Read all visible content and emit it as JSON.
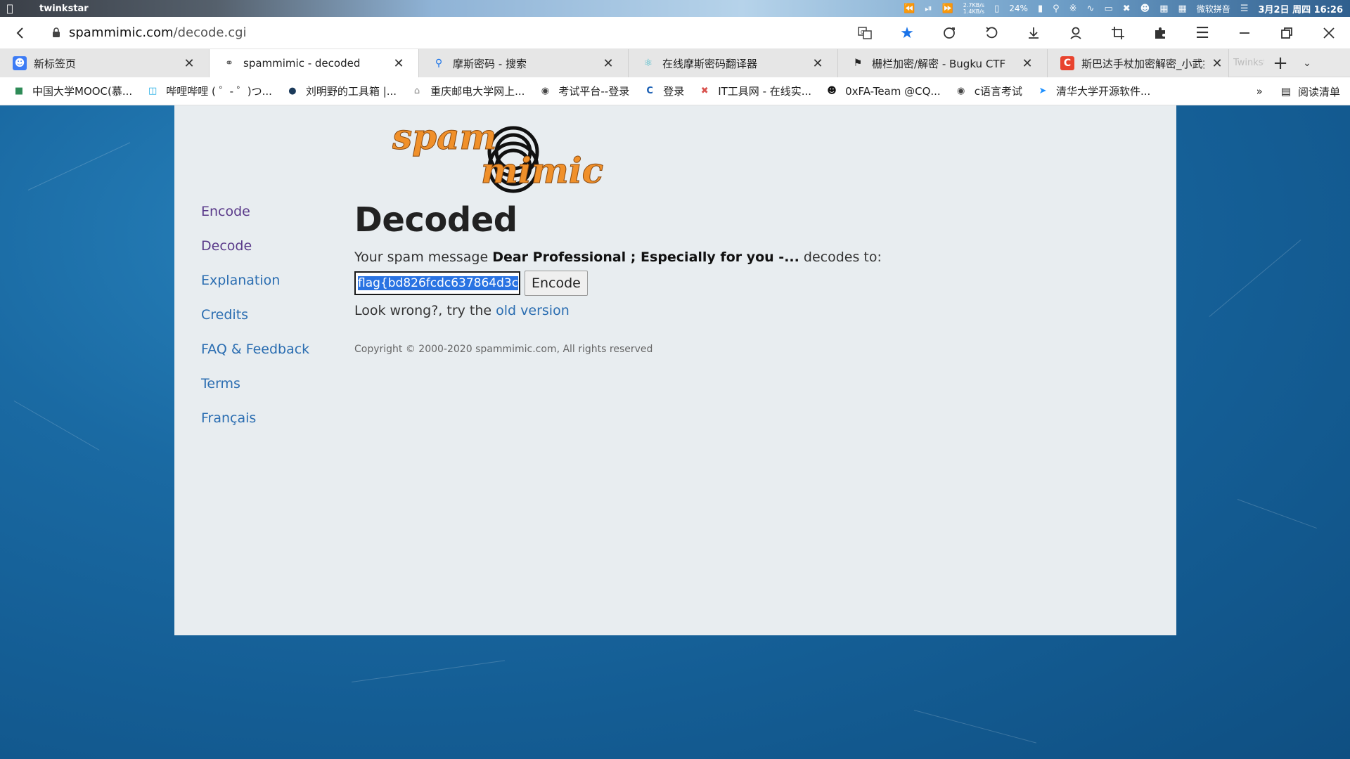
{
  "system": {
    "user": "twinkstar",
    "net_up": "2.7KB/s",
    "net_down": "1.4KB/s",
    "battery": "24%",
    "ime": "微软拼音",
    "clock": "3月2日 周四 16:26"
  },
  "address": {
    "domain": "spammimic.com",
    "path": "/decode.cgi"
  },
  "tabs": [
    {
      "label": "新标签页",
      "icon": "new-tab-icon",
      "color": "#3d7cf5"
    },
    {
      "label": "spammimic - decoded",
      "icon": "spammimic-favicon",
      "color": "#555555"
    },
    {
      "label": "摩斯密码 - 搜索",
      "icon": "search-icon",
      "color": "#1a73e8"
    },
    {
      "label": "在线摩斯密码翻译器",
      "icon": "react-icon",
      "color": "#3fb8c9"
    },
    {
      "label": "栅栏加密/解密 - Bugku CTF",
      "icon": "flag-icon",
      "color": "#222222"
    },
    {
      "label": "斯巴达手杖加密解密_小武搞渗",
      "icon": "csdn-icon",
      "color": "#e8432e"
    }
  ],
  "tab_overflow_text": "Twinkstar Browser",
  "bookmarks": [
    {
      "label": "中国大学MOOC(慕...",
      "icon": "mooc-icon"
    },
    {
      "label": "哔哩哔哩 ( ゜- ゜)つ...",
      "icon": "bilibili-icon"
    },
    {
      "label": "刘明野的工具箱 |...",
      "icon": "toolbox-icon"
    },
    {
      "label": "重庆邮电大学网上...",
      "icon": "home-icon"
    },
    {
      "label": "考试平台--登录",
      "icon": "globe-icon"
    },
    {
      "label": "登录",
      "icon": "c-icon"
    },
    {
      "label": "IT工具网 - 在线实...",
      "icon": "tools-icon"
    },
    {
      "label": "0xFA-Team @CQ...",
      "icon": "cat-icon"
    },
    {
      "label": "c语言考试",
      "icon": "globe-icon"
    },
    {
      "label": "清华大学开源软件...",
      "icon": "tuna-icon"
    }
  ],
  "reader_mode": "阅读清单",
  "nav": [
    {
      "label": "Encode"
    },
    {
      "label": "Decode"
    },
    {
      "label": "Explanation"
    },
    {
      "label": "Credits"
    },
    {
      "label": "FAQ & Feedback"
    },
    {
      "label": "Terms"
    },
    {
      "label": "Français"
    }
  ],
  "page": {
    "title": "Decoded",
    "msg_prefix": "Your spam message",
    "msg_bold": "Dear Professional ; Especially for you -...",
    "msg_suffix": "decodes to:",
    "decoded_value": "flag{bd826fcdc637864d3c",
    "encode_button": "Encode",
    "wrong_prefix": "Look wrong?, try the",
    "old_version_link": "old version",
    "copyright": "Copyright © 2000-2020 spammimic.com, All rights reserved"
  },
  "logo": {
    "word1": "spam",
    "word2": "mimic",
    "color": "#f0902a"
  }
}
